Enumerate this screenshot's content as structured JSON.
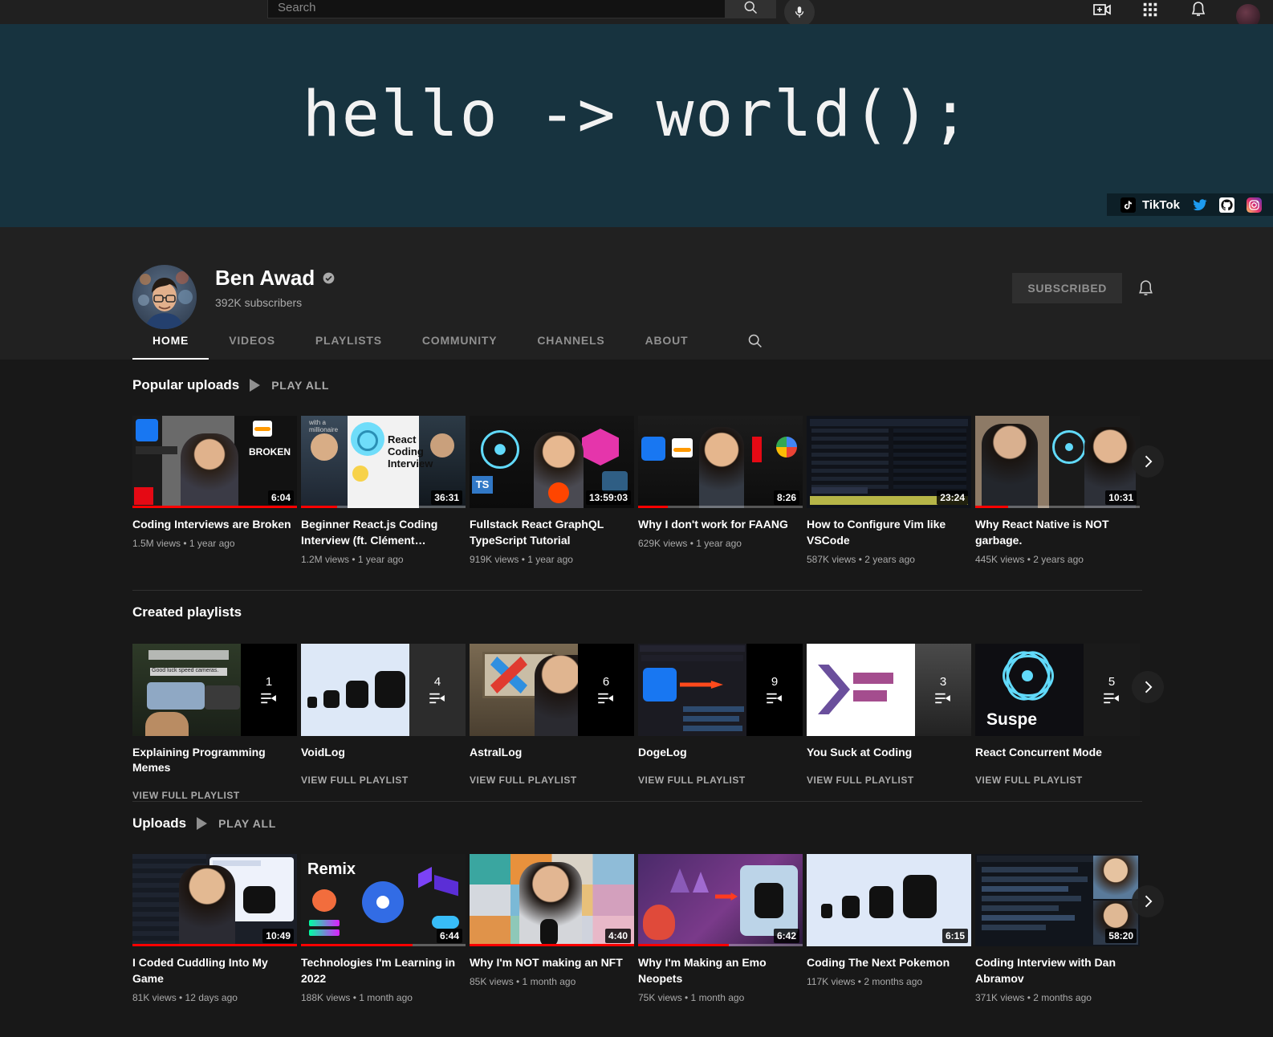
{
  "topbar": {
    "search_placeholder": "Search",
    "search_value": "",
    "icons": [
      "search-icon",
      "mic-icon",
      "create-video-icon",
      "apps-grid-icon",
      "notifications-bell-icon",
      "account-avatar"
    ]
  },
  "banner": {
    "text": "hello -> world();",
    "background_color": "#17333f",
    "social": [
      {
        "name": "tiktok",
        "label": "TikTok"
      },
      {
        "name": "twitter",
        "label": ""
      },
      {
        "name": "github",
        "label": ""
      },
      {
        "name": "instagram",
        "label": ""
      }
    ]
  },
  "channel": {
    "name": "Ben Awad",
    "verified": true,
    "subscribers": "392K subscribers",
    "subscribe_label": "SUBSCRIBED",
    "notification_icon": "bell-icon"
  },
  "tabs": [
    {
      "label": "HOME",
      "active": true
    },
    {
      "label": "VIDEOS",
      "active": false
    },
    {
      "label": "PLAYLISTS",
      "active": false
    },
    {
      "label": "COMMUNITY",
      "active": false
    },
    {
      "label": "CHANNELS",
      "active": false
    },
    {
      "label": "ABOUT",
      "active": false
    }
  ],
  "shelves": {
    "popular": {
      "title": "Popular uploads",
      "play_all": "PLAY ALL",
      "videos": [
        {
          "title": "Coding Interviews are Broken",
          "meta": "1.5M views • 1 year ago",
          "duration": "6:04",
          "progress": 100
        },
        {
          "title": "Beginner React.js Coding Interview (ft. Clément…",
          "meta": "1.2M views • 1 year ago",
          "duration": "36:31",
          "progress": 22
        },
        {
          "title": "Fullstack React GraphQL TypeScript Tutorial",
          "meta": "919K views • 1 year ago",
          "duration": "13:59:03",
          "progress": 0
        },
        {
          "title": "Why I don't work for FAANG",
          "meta": "629K views • 1 year ago",
          "duration": "8:26",
          "progress": 18
        },
        {
          "title": "How to Configure Vim like VSCode",
          "meta": "587K views • 2 years ago",
          "duration": "23:24",
          "progress": 0
        },
        {
          "title": "Why React Native is NOT garbage.",
          "meta": "445K views • 2 years ago",
          "duration": "10:31",
          "progress": 20
        }
      ]
    },
    "playlists": {
      "title": "Created playlists",
      "view_link": "VIEW FULL PLAYLIST",
      "items": [
        {
          "title": "Explaining Programming Memes",
          "count": "1"
        },
        {
          "title": "VoidLog",
          "count": "4"
        },
        {
          "title": "AstralLog",
          "count": "6"
        },
        {
          "title": "DogeLog",
          "count": "9"
        },
        {
          "title": "You Suck at Coding",
          "count": "3"
        },
        {
          "title": "React Concurrent Mode",
          "count": "5"
        }
      ]
    },
    "uploads": {
      "title": "Uploads",
      "play_all": "PLAY ALL",
      "videos": [
        {
          "title": "I Coded Cuddling Into My Game",
          "meta": "81K views • 12 days ago",
          "duration": "10:49",
          "progress": 100
        },
        {
          "title": "Technologies I'm Learning in 2022",
          "meta": "188K views • 1 month ago",
          "duration": "6:44",
          "progress": 68
        },
        {
          "title": "Why I'm NOT making an NFT",
          "meta": "85K views • 1 month ago",
          "duration": "4:40",
          "progress": 100
        },
        {
          "title": "Why I'm Making an Emo Neopets",
          "meta": "75K views • 1 month ago",
          "duration": "6:42",
          "progress": 55
        },
        {
          "title": "Coding The Next Pokemon",
          "meta": "117K views • 2 months ago",
          "duration": "6:15",
          "progress": 0
        },
        {
          "title": "Coding Interview with Dan Abramov",
          "meta": "371K views • 2 months ago",
          "duration": "58:20",
          "progress": 0
        }
      ]
    }
  },
  "colors": {
    "page_bg": "#181818",
    "header_bg": "#212121",
    "banner_bg": "#17333f",
    "accent_red": "#ff0000",
    "muted_text": "#aaaaaa"
  }
}
